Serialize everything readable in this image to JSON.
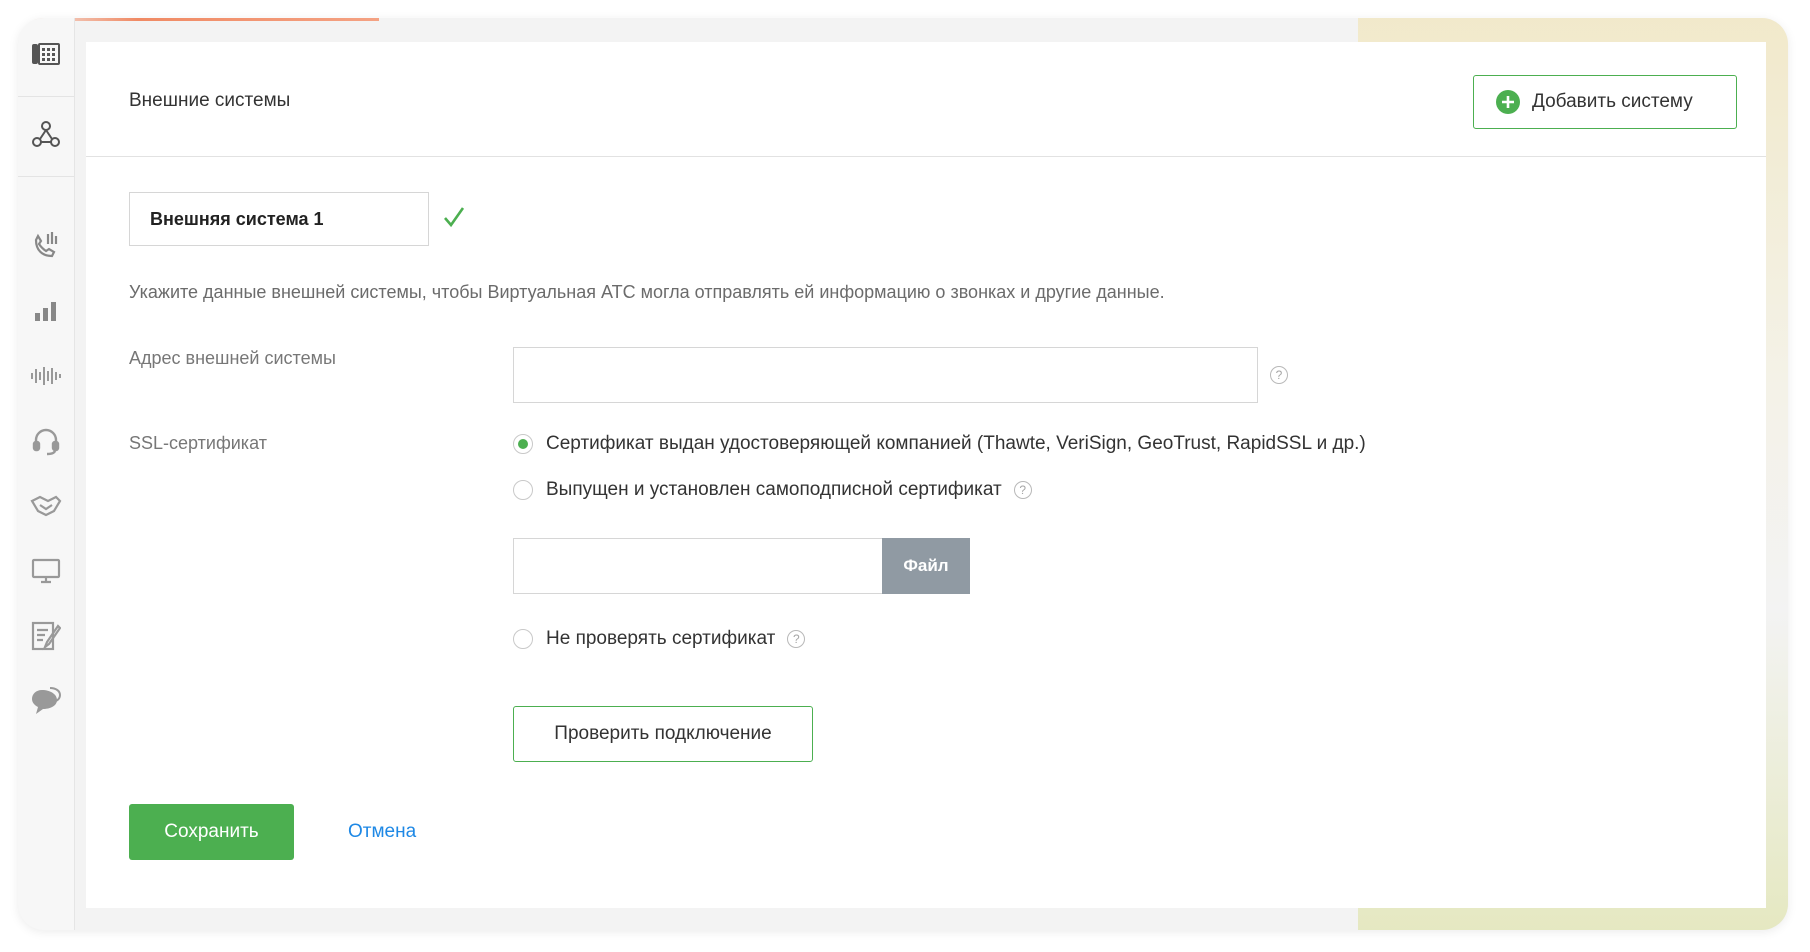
{
  "header": {
    "title": "Внешние системы",
    "add_button_label": "Добавить систему"
  },
  "form": {
    "system_name": "Внешняя система 1",
    "hint": "Укажите данные внешней системы, чтобы Виртуальная АТС могла отправлять ей информацию о звонках и другие данные.",
    "address_label": "Адрес внешней системы",
    "address_value": "",
    "ssl_label": "SSL-сертификат",
    "ssl_options": [
      {
        "label": "Сертификат выдан удостоверяющей компанией (Thawte, VeriSign, GeoTrust, RapidSSL и др.)",
        "selected": true
      },
      {
        "label": "Выпущен и установлен самоподписной сертификат",
        "selected": false
      },
      {
        "label": "Не проверять сертификат",
        "selected": false
      }
    ],
    "file_button_label": "Файл",
    "check_button_label": "Проверить подключение",
    "help_glyph": "?"
  },
  "actions": {
    "save_label": "Сохранить",
    "cancel_label": "Отмена"
  },
  "colors": {
    "accent_green": "#4caf50",
    "link_blue": "#1e88e5",
    "file_button_gray": "#909aa3"
  },
  "sidebar": {
    "icons": [
      "pbx-icon",
      "webhook-icon",
      "call-tracking-icon",
      "stats-icon",
      "recordings-icon",
      "headset-icon",
      "handshake-icon",
      "monitor-icon",
      "form-icon",
      "chat-icon"
    ]
  }
}
